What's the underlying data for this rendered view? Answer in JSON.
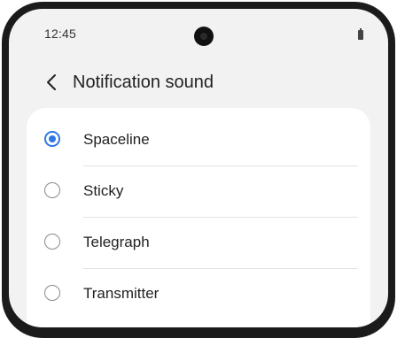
{
  "status_bar": {
    "time": "12:45",
    "camera_icon": "front-camera-icon",
    "battery_icon": "battery-icon"
  },
  "header": {
    "back_icon": "chevron-left-icon",
    "title": "Notification sound"
  },
  "sounds": [
    {
      "label": "Spaceline",
      "selected": true
    },
    {
      "label": "Sticky",
      "selected": false
    },
    {
      "label": "Telegraph",
      "selected": false
    },
    {
      "label": "Transmitter",
      "selected": false
    }
  ],
  "colors": {
    "accent": "#2f78e4",
    "background": "#f2f2f2",
    "card": "#ffffff"
  }
}
